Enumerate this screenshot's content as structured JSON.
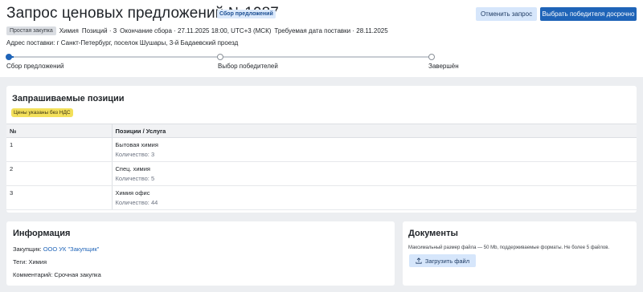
{
  "header": {
    "title": "Запрос ценовых предложений №1087",
    "status_badge": "Сбор предложений",
    "cancel_label": "Отменить запрос",
    "choose_winner_label": "Выбрать победителя досрочно"
  },
  "meta": {
    "type_tag": "Простая закупка",
    "category": "Химия",
    "positions": "Позиций · 3",
    "deadline": "Окончание сбора · 27.11.2025 18:00, UTC+3 (МСК)",
    "delivery": "Требуемая дата поставки · 28.11.2025",
    "address_label": "Адрес поставки:",
    "address_value": "г Санкт-Петербург, поселок Шушары, 3-й Бадаевский проезд"
  },
  "steps": [
    {
      "label": "Сбор предложений",
      "active": true
    },
    {
      "label": "Выбор победителей",
      "active": false
    },
    {
      "label": "Завершён",
      "active": false
    }
  ],
  "positions": {
    "title": "Запрашиваемые позиции",
    "vat_note": "Цены указаны без НДС",
    "columns": [
      "№",
      "Позиции / Услуга"
    ],
    "rows": [
      {
        "num": "1",
        "name": "Бытовая химия",
        "qty": "Количество: 3"
      },
      {
        "num": "2",
        "name": "Спец. химия",
        "qty": "Количество: 5"
      },
      {
        "num": "3",
        "name": "Химия офис",
        "qty": "Количество: 44"
      }
    ]
  },
  "info": {
    "title": "Информация",
    "buyer_label": "Закупщик:",
    "buyer_value": "ООО УК \"Закупщик\"",
    "tags_label": "Теги:",
    "tags_value": "Химия",
    "comment_label": "Комментарий:",
    "comment_value": "Срочная закупка"
  },
  "docs": {
    "title": "Документы",
    "note": "Максимальный размер файла — 50 Mb, поддерживаемые форматы. Не более 5 файлов.",
    "upload_label": "Загрузить файл",
    "upload_icon": "upload-icon"
  },
  "colors": {
    "accent": "#1f64b8",
    "badge_bg": "#dbe9fb",
    "vat_badge_bg": "#f3e05a"
  }
}
